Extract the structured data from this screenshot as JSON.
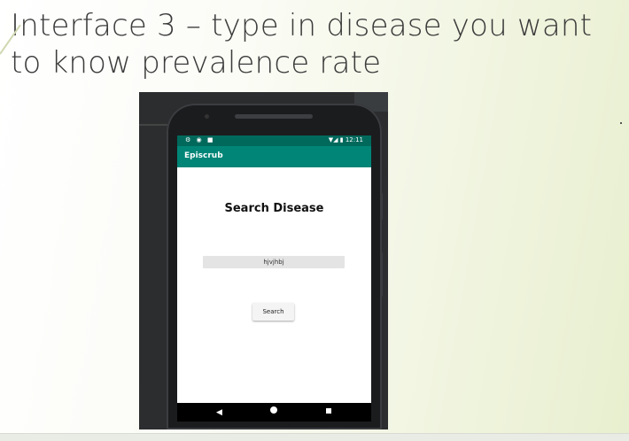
{
  "slide": {
    "title_line1": "Interface 3 – type in disease you want",
    "title_line2": "to know prevalence rate"
  },
  "emulator": {
    "toolbar_icon": "eye-icon"
  },
  "phone": {
    "status_bar": {
      "left_icons": "⚙ ◉ ■",
      "right_icons": "▼◢ ▮",
      "time": "12:11"
    },
    "app_bar": {
      "title": "Episcrub"
    },
    "content": {
      "heading": "Search Disease",
      "search_input_value": "hjvjhbj",
      "search_button_label": "Search"
    },
    "nav_bar": {
      "back_icon": "back-triangle-icon",
      "home_icon": "home-circle-icon",
      "recents_icon": "recents-square-icon"
    },
    "colors": {
      "status_bar": "#00695c",
      "app_bar": "#008577"
    }
  }
}
